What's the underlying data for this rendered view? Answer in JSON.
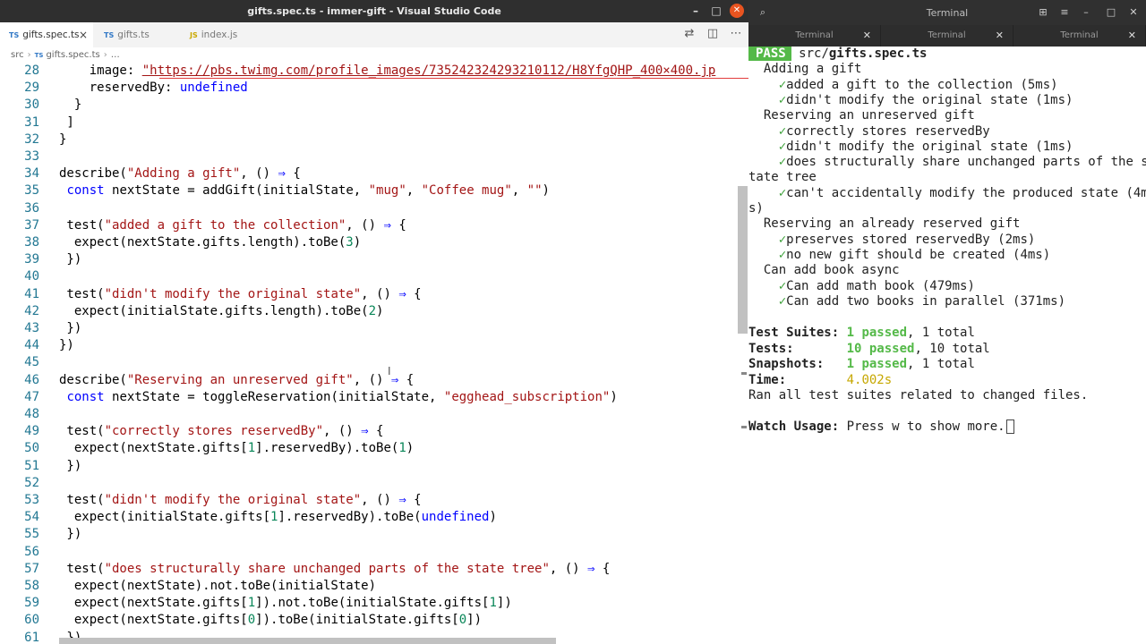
{
  "vscode": {
    "window_title": "gifts.spec.ts - immer-gift - Visual Studio Code",
    "tabs": [
      {
        "type": "TS",
        "label": "gifts.spec.ts",
        "close": "×"
      },
      {
        "type": "TS",
        "label": "gifts.ts"
      },
      {
        "type": "JS",
        "label": "index.js"
      }
    ],
    "breadcrumb": {
      "folder": "src",
      "file_type": "TS",
      "file": "gifts.spec.ts",
      "tail": "…"
    },
    "lines": [
      {
        "n": "28",
        "tokens": [
          {
            "t": "    image: "
          },
          {
            "t": "\"https://pbs.twimg.com/profile_images/735242324293210112/H8YfgQHP_400×400.jp",
            "c": "u"
          }
        ]
      },
      {
        "n": "29",
        "tokens": [
          {
            "t": "    reservedBy: "
          },
          {
            "t": "undefined",
            "c": "k"
          }
        ]
      },
      {
        "n": "30",
        "tokens": [
          {
            "t": "  }"
          }
        ]
      },
      {
        "n": "31",
        "tokens": [
          {
            "t": " ]"
          }
        ]
      },
      {
        "n": "32",
        "tokens": [
          {
            "t": "}"
          }
        ]
      },
      {
        "n": "33",
        "tokens": []
      },
      {
        "n": "34",
        "tokens": [
          {
            "t": "describe("
          },
          {
            "t": "\"Adding a gift\"",
            "c": "s"
          },
          {
            "t": ", () "
          },
          {
            "t": "⇒",
            "c": "k"
          },
          {
            "t": " {"
          }
        ]
      },
      {
        "n": "35",
        "tokens": [
          {
            "t": " "
          },
          {
            "t": "const",
            "c": "k"
          },
          {
            "t": " nextState = addGift(initialState, "
          },
          {
            "t": "\"mug\"",
            "c": "s"
          },
          {
            "t": ", "
          },
          {
            "t": "\"Coffee mug\"",
            "c": "s"
          },
          {
            "t": ", "
          },
          {
            "t": "\"\"",
            "c": "s"
          },
          {
            "t": ")"
          }
        ]
      },
      {
        "n": "36",
        "tokens": []
      },
      {
        "n": "37",
        "tokens": [
          {
            "t": " test("
          },
          {
            "t": "\"added a gift to the collection\"",
            "c": "s"
          },
          {
            "t": ", () "
          },
          {
            "t": "⇒",
            "c": "k"
          },
          {
            "t": " {"
          }
        ]
      },
      {
        "n": "38",
        "tokens": [
          {
            "t": "  expect(nextState.gifts.length).toBe("
          },
          {
            "t": "3",
            "c": "n"
          },
          {
            "t": ")"
          }
        ]
      },
      {
        "n": "39",
        "tokens": [
          {
            "t": " })"
          }
        ]
      },
      {
        "n": "40",
        "tokens": []
      },
      {
        "n": "41",
        "tokens": [
          {
            "t": " test("
          },
          {
            "t": "\"didn't modify the original state\"",
            "c": "s"
          },
          {
            "t": ", () "
          },
          {
            "t": "⇒",
            "c": "k"
          },
          {
            "t": " {"
          }
        ]
      },
      {
        "n": "42",
        "tokens": [
          {
            "t": "  expect(initialState.gifts.length).toBe("
          },
          {
            "t": "2",
            "c": "n"
          },
          {
            "t": ")"
          }
        ]
      },
      {
        "n": "43",
        "tokens": [
          {
            "t": " })"
          }
        ]
      },
      {
        "n": "44",
        "tokens": [
          {
            "t": "})"
          }
        ]
      },
      {
        "n": "45",
        "tokens": []
      },
      {
        "n": "46",
        "tokens": [
          {
            "t": "describe("
          },
          {
            "t": "\"Reserving an unreserved gift\"",
            "c": "s"
          },
          {
            "t": ", () "
          },
          {
            "t": "⇒",
            "c": "k"
          },
          {
            "t": " {"
          }
        ]
      },
      {
        "n": "47",
        "tokens": [
          {
            "t": " "
          },
          {
            "t": "const",
            "c": "k"
          },
          {
            "t": " nextState = toggleReservation(initialState, "
          },
          {
            "t": "\"egghead_subscription\"",
            "c": "s"
          },
          {
            "t": ")"
          }
        ]
      },
      {
        "n": "48",
        "tokens": []
      },
      {
        "n": "49",
        "tokens": [
          {
            "t": " test("
          },
          {
            "t": "\"correctly stores reservedBy\"",
            "c": "s"
          },
          {
            "t": ", () "
          },
          {
            "t": "⇒",
            "c": "k"
          },
          {
            "t": " {"
          }
        ]
      },
      {
        "n": "50",
        "tokens": [
          {
            "t": "  expect(nextState.gifts["
          },
          {
            "t": "1",
            "c": "n"
          },
          {
            "t": "].reservedBy).toBe("
          },
          {
            "t": "1",
            "c": "n"
          },
          {
            "t": ")"
          }
        ]
      },
      {
        "n": "51",
        "tokens": [
          {
            "t": " })"
          }
        ]
      },
      {
        "n": "52",
        "tokens": []
      },
      {
        "n": "53",
        "tokens": [
          {
            "t": " test("
          },
          {
            "t": "\"didn't modify the original state\"",
            "c": "s"
          },
          {
            "t": ", () "
          },
          {
            "t": "⇒",
            "c": "k"
          },
          {
            "t": " {"
          }
        ]
      },
      {
        "n": "54",
        "tokens": [
          {
            "t": "  expect(initialState.gifts["
          },
          {
            "t": "1",
            "c": "n"
          },
          {
            "t": "].reservedBy).toBe("
          },
          {
            "t": "undefined",
            "c": "k"
          },
          {
            "t": ")"
          }
        ]
      },
      {
        "n": "55",
        "tokens": [
          {
            "t": " })"
          }
        ]
      },
      {
        "n": "56",
        "tokens": []
      },
      {
        "n": "57",
        "tokens": [
          {
            "t": " test("
          },
          {
            "t": "\"does structurally share unchanged parts of the state tree\"",
            "c": "s"
          },
          {
            "t": ", () "
          },
          {
            "t": "⇒",
            "c": "k"
          },
          {
            "t": " {"
          }
        ]
      },
      {
        "n": "58",
        "tokens": [
          {
            "t": "  expect(nextState).not.toBe(initialState)"
          }
        ]
      },
      {
        "n": "59",
        "tokens": [
          {
            "t": "  expect(nextState.gifts["
          },
          {
            "t": "1",
            "c": "n"
          },
          {
            "t": "]).not.toBe(initialState.gifts["
          },
          {
            "t": "1",
            "c": "n"
          },
          {
            "t": "])"
          }
        ]
      },
      {
        "n": "60",
        "tokens": [
          {
            "t": "  expect(nextState.gifts["
          },
          {
            "t": "0",
            "c": "n"
          },
          {
            "t": "]).toBe(initialState.gifts["
          },
          {
            "t": "0",
            "c": "n"
          },
          {
            "t": "])"
          }
        ]
      },
      {
        "n": "61",
        "tokens": [
          {
            "t": " })"
          }
        ]
      }
    ]
  },
  "terminal": {
    "window_title": "Terminal",
    "tabs": [
      "Terminal",
      "Terminal",
      "Terminal"
    ],
    "pass_badge": "PASS",
    "file_dir": "src/",
    "file_name": "gifts.spec.ts",
    "output": [
      {
        "indent": "  ",
        "text": "Adding a gift"
      },
      {
        "indent": "    ",
        "check": "✓",
        "text": "added a gift to the collection (5ms)"
      },
      {
        "indent": "    ",
        "check": "✓",
        "text": "didn't modify the original state (1ms)"
      },
      {
        "indent": "  ",
        "text": "Reserving an unreserved gift"
      },
      {
        "indent": "    ",
        "check": "✓",
        "text": "correctly stores reservedBy"
      },
      {
        "indent": "    ",
        "check": "✓",
        "text": "didn't modify the original state (1ms)"
      },
      {
        "indent": "    ",
        "check": "✓",
        "text": "does structurally share unchanged parts of the s"
      },
      {
        "indent": "",
        "text": "tate tree"
      },
      {
        "indent": "    ",
        "check": "✓",
        "text": "can't accidentally modify the produced state (4m"
      },
      {
        "indent": "",
        "text": "s)"
      },
      {
        "indent": "  ",
        "text": "Reserving an already reserved gift"
      },
      {
        "indent": "    ",
        "check": "✓",
        "text": "preserves stored reservedBy (2ms)"
      },
      {
        "indent": "    ",
        "check": "✓",
        "text": "no new gift should be created (4ms)"
      },
      {
        "indent": "  ",
        "text": "Can add book async"
      },
      {
        "indent": "    ",
        "check": "✓",
        "text": "Can add math book (479ms)"
      },
      {
        "indent": "    ",
        "check": "✓",
        "text": "Can add two books in parallel (371ms)"
      }
    ],
    "summary": {
      "suites_label": "Test Suites:",
      "suites_passed": "1 passed",
      "suites_total": ", 1 total",
      "tests_label": "Tests:",
      "tests_passed": "10 passed",
      "tests_total": ", 10 total",
      "snapshots_label": "Snapshots:",
      "snapshots_passed": "1 passed",
      "snapshots_total": ", 1 total",
      "time_label": "Time:",
      "time_value": "4.002s",
      "ran_all": "Ran all test suites related to changed files."
    },
    "watch_label": "Watch Usage:",
    "watch_text": " Press w to show more."
  }
}
